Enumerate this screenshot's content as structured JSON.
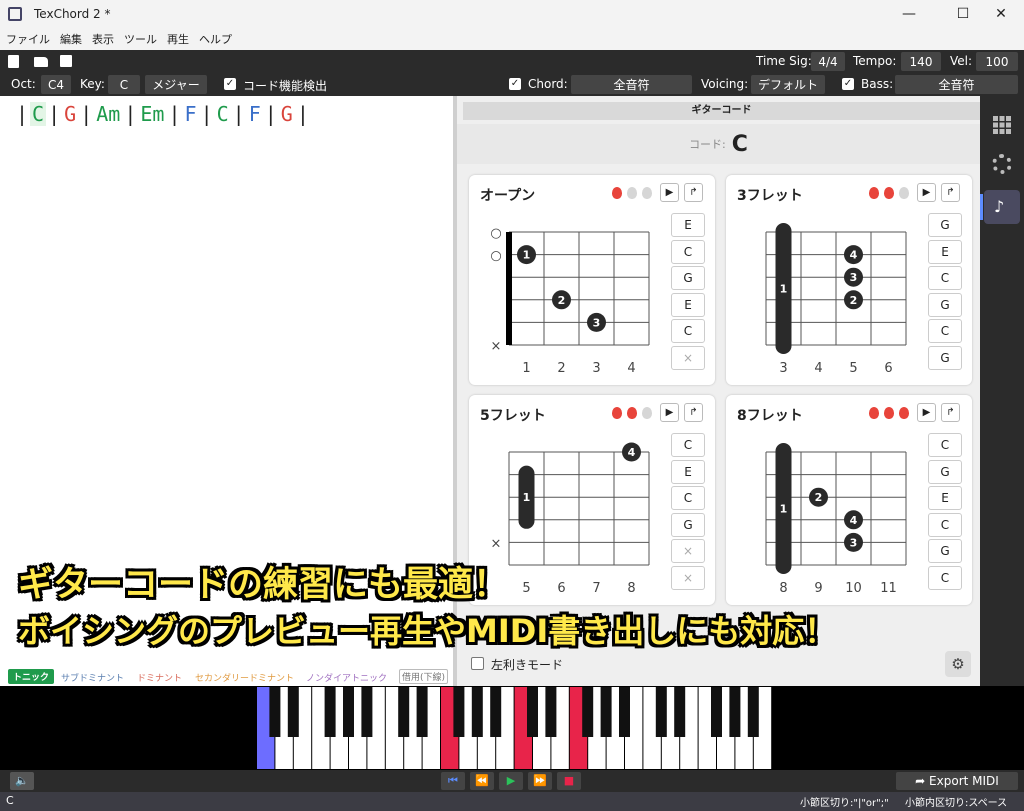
{
  "window": {
    "title": "TexChord 2 *",
    "minimize": "—",
    "maximize": "☐",
    "close": "✕"
  },
  "menu": [
    "ファイル",
    "編集",
    "表示",
    "ツール",
    "再生",
    "ヘルプ"
  ],
  "toolbar": {
    "time_sig_label": "Time Sig:",
    "time_sig": "4/4",
    "tempo_label": "Tempo:",
    "tempo": "140",
    "vel_label": "Vel:",
    "vel": "100",
    "oct_label": "Oct:",
    "oct": "C4",
    "key_label": "Key:",
    "key": "C",
    "mode": "メジャー",
    "chord_detect_label": "コード機能検出",
    "chord_label": "Chord:",
    "chord_value": "全音符",
    "voicing_label": "Voicing:",
    "voicing_value": "デフォルト",
    "bass_label": "Bass:",
    "bass_value": "全音符"
  },
  "progression": [
    {
      "name": "C",
      "color": "#1f9b4c"
    },
    {
      "name": "G",
      "color": "#d9443b"
    },
    {
      "name": "Am",
      "color": "#1f9b4c"
    },
    {
      "name": "Em",
      "color": "#1f9b4c"
    },
    {
      "name": "F",
      "color": "#3a6fc9"
    },
    {
      "name": "C",
      "color": "#1f9b4c"
    },
    {
      "name": "F",
      "color": "#3a6fc9"
    },
    {
      "name": "G",
      "color": "#d9443b"
    }
  ],
  "legend": {
    "tonic": "トニック",
    "subdominant": "サブドミナント",
    "dominant": "ドミナント",
    "secondary": "セカンダリードミナント",
    "nondiatonic": "ノンダイアトニック",
    "borrowed": "借用(下線)"
  },
  "panel": {
    "header": "ギターコード",
    "chord_label": "コード:",
    "chord_name": "C",
    "left_hand_label": "左利きモード"
  },
  "cards": [
    {
      "title": "オープン",
      "difficulty": 1,
      "notes": [
        "E",
        "C",
        "G",
        "E",
        "C",
        "×"
      ],
      "fret_numbers": [
        "1",
        "2",
        "3",
        "4"
      ],
      "markers": [
        "○",
        "○",
        "",
        "",
        "",
        "×"
      ],
      "fingers": [
        {
          "s": 1,
          "f": 1,
          "n": "1"
        },
        {
          "s": 3,
          "f": 2,
          "n": "2"
        },
        {
          "s": 4,
          "f": 3,
          "n": "3"
        }
      ],
      "barre": null,
      "nut": true
    },
    {
      "title": "3フレット",
      "difficulty": 2,
      "notes": [
        "G",
        "E",
        "C",
        "G",
        "C",
        "G"
      ],
      "fret_numbers": [
        "3",
        "4",
        "5",
        "6"
      ],
      "markers": [
        "",
        "",
        "",
        "",
        "",
        ""
      ],
      "fingers": [
        {
          "s": 1,
          "f": 3,
          "n": "4"
        },
        {
          "s": 2,
          "f": 3,
          "n": "3"
        },
        {
          "s": 3,
          "f": 3,
          "n": "2"
        }
      ],
      "barre": {
        "f": 1,
        "from": 0,
        "to": 5,
        "n": "1"
      },
      "nut": false
    },
    {
      "title": "5フレット",
      "difficulty": 2,
      "notes": [
        "C",
        "E",
        "C",
        "G",
        "×",
        "×"
      ],
      "fret_numbers": [
        "5",
        "6",
        "7",
        "8"
      ],
      "markers": [
        "",
        "",
        "",
        "",
        "×",
        ""
      ],
      "fingers": [
        {
          "s": 0,
          "f": 4,
          "n": "4"
        }
      ],
      "barre": {
        "f": 1,
        "from": 1,
        "to": 3,
        "n": "1"
      },
      "nut": false
    },
    {
      "title": "8フレット",
      "difficulty": 3,
      "notes": [
        "C",
        "G",
        "E",
        "C",
        "G",
        "C"
      ],
      "fret_numbers": [
        "8",
        "9",
        "10",
        "11"
      ],
      "markers": [
        "",
        "",
        "",
        "",
        "",
        ""
      ],
      "fingers": [
        {
          "s": 2,
          "f": 2,
          "n": "2"
        },
        {
          "s": 3,
          "f": 3,
          "n": "4"
        },
        {
          "s": 4,
          "f": 3,
          "n": "3"
        }
      ],
      "barre": {
        "f": 1,
        "from": 0,
        "to": 5,
        "n": "1"
      },
      "nut": false
    }
  ],
  "piano": {
    "highlight_colors": {
      "bass": "#6d6dff",
      "chord": "#e8244a"
    },
    "highlighted_keys": [
      0,
      10,
      14,
      17
    ]
  },
  "transport": {
    "export_label": "Export MIDI"
  },
  "status": {
    "chord": "C",
    "hint1": "小節区切り:\"|\"or\";\"",
    "hint2": "小節内区切り:スペース"
  },
  "banner": {
    "line1": "ギターコードの練習にも最適！",
    "line2": "ボイシングのプレビュー再生やMIDI書き出しにも対応！"
  }
}
